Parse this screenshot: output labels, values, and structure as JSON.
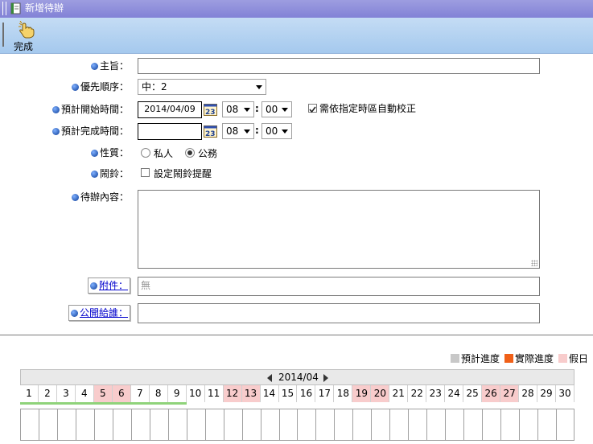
{
  "window": {
    "title": "新增待辦"
  },
  "toolbar": {
    "done_label": "完成"
  },
  "form": {
    "subject": {
      "label": "主旨：",
      "value": ""
    },
    "priority": {
      "label": "優先順序：",
      "selected": "中：2"
    },
    "start": {
      "label": "預計開始時間：",
      "date": "2014/04/09",
      "hour": "08",
      "minute": "00"
    },
    "timezone_checkbox": {
      "label": "需依指定時區自動校正",
      "checked": true
    },
    "end": {
      "label": "預計完成時間：",
      "date": "",
      "hour": "08",
      "minute": "00"
    },
    "nature": {
      "label": "性質：",
      "options": [
        "私人",
        "公務"
      ],
      "selected": "公務"
    },
    "alarm": {
      "label": "鬧鈴：",
      "checkbox_label": "設定鬧鈴提醒",
      "checked": false
    },
    "content": {
      "label": "待辦內容：",
      "value": ""
    },
    "attachment": {
      "label": "附件：",
      "value": "無"
    },
    "share": {
      "label": "公開給誰：",
      "value": ""
    }
  },
  "calendar": {
    "legend": {
      "planned": "預計進度",
      "actual": "實際進度",
      "holiday": "假日"
    },
    "colors": {
      "planned": "#c8c8c8",
      "actual": "#f06018",
      "holiday": "#f8cccc"
    },
    "month": "2014/04",
    "days": [
      1,
      2,
      3,
      4,
      5,
      6,
      7,
      8,
      9,
      10,
      11,
      12,
      13,
      14,
      15,
      16,
      17,
      18,
      19,
      20,
      21,
      22,
      23,
      24,
      25,
      26,
      27,
      28,
      29,
      30
    ],
    "holidays": [
      5,
      6,
      12,
      13,
      19,
      20,
      26,
      27
    ],
    "progress_days": 9
  }
}
